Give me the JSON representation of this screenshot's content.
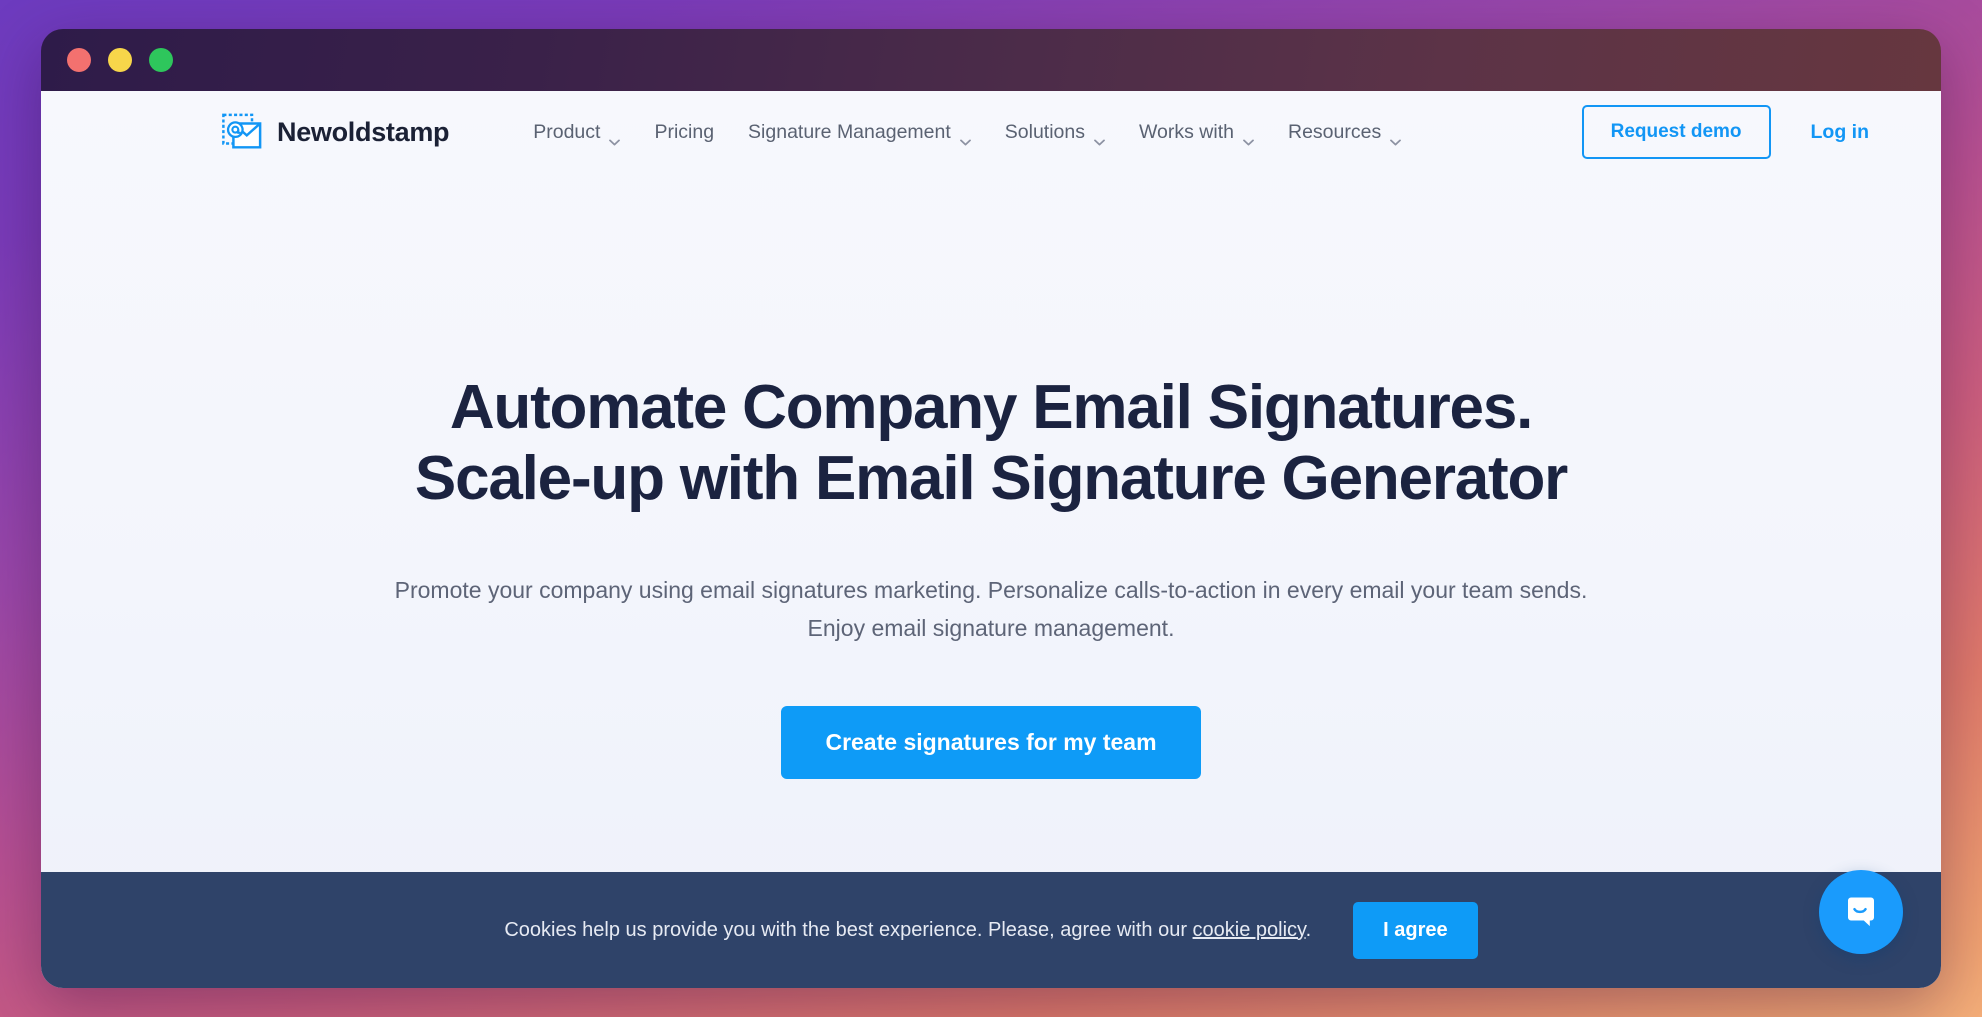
{
  "window": {
    "traffic_lights": [
      {
        "name": "close",
        "color": "#f3716f"
      },
      {
        "name": "minimize",
        "color": "#f7d64a"
      },
      {
        "name": "maximize",
        "color": "#2ec65c"
      }
    ]
  },
  "brand": {
    "name": "Newoldstamp",
    "icon": "stamp-envelope-at-icon",
    "color": "#1296f5"
  },
  "nav": {
    "items": [
      {
        "label": "Product",
        "has_dropdown": true
      },
      {
        "label": "Pricing",
        "has_dropdown": false
      },
      {
        "label": "Signature Management",
        "has_dropdown": true
      },
      {
        "label": "Solutions",
        "has_dropdown": true
      },
      {
        "label": "Works with",
        "has_dropdown": true
      },
      {
        "label": "Resources",
        "has_dropdown": true
      }
    ],
    "demo_button": "Request demo",
    "login_link": "Log in"
  },
  "hero": {
    "title_line1": "Automate Company Email Signatures.",
    "title_line2": "Scale-up with Email Signature Generator",
    "subtitle": "Promote your company using email signatures marketing. Personalize calls-to-action in every email your team sends. Enjoy email signature management.",
    "cta_button": "Create signatures for my team"
  },
  "cookie_banner": {
    "text_before": "Cookies help us provide you with the best experience. Please, agree with our ",
    "link": "cookie policy",
    "text_after": ".",
    "agree_button": "I agree",
    "background": "#2f4369"
  },
  "chat": {
    "icon": "chat-bubble-smile-icon",
    "color": "#1a9bfc"
  },
  "theme": {
    "accent_blue": "#0e9bf7",
    "heading_navy": "#1b2340",
    "body_gray": "#5d6477",
    "page_background": "#f5f6fc"
  }
}
